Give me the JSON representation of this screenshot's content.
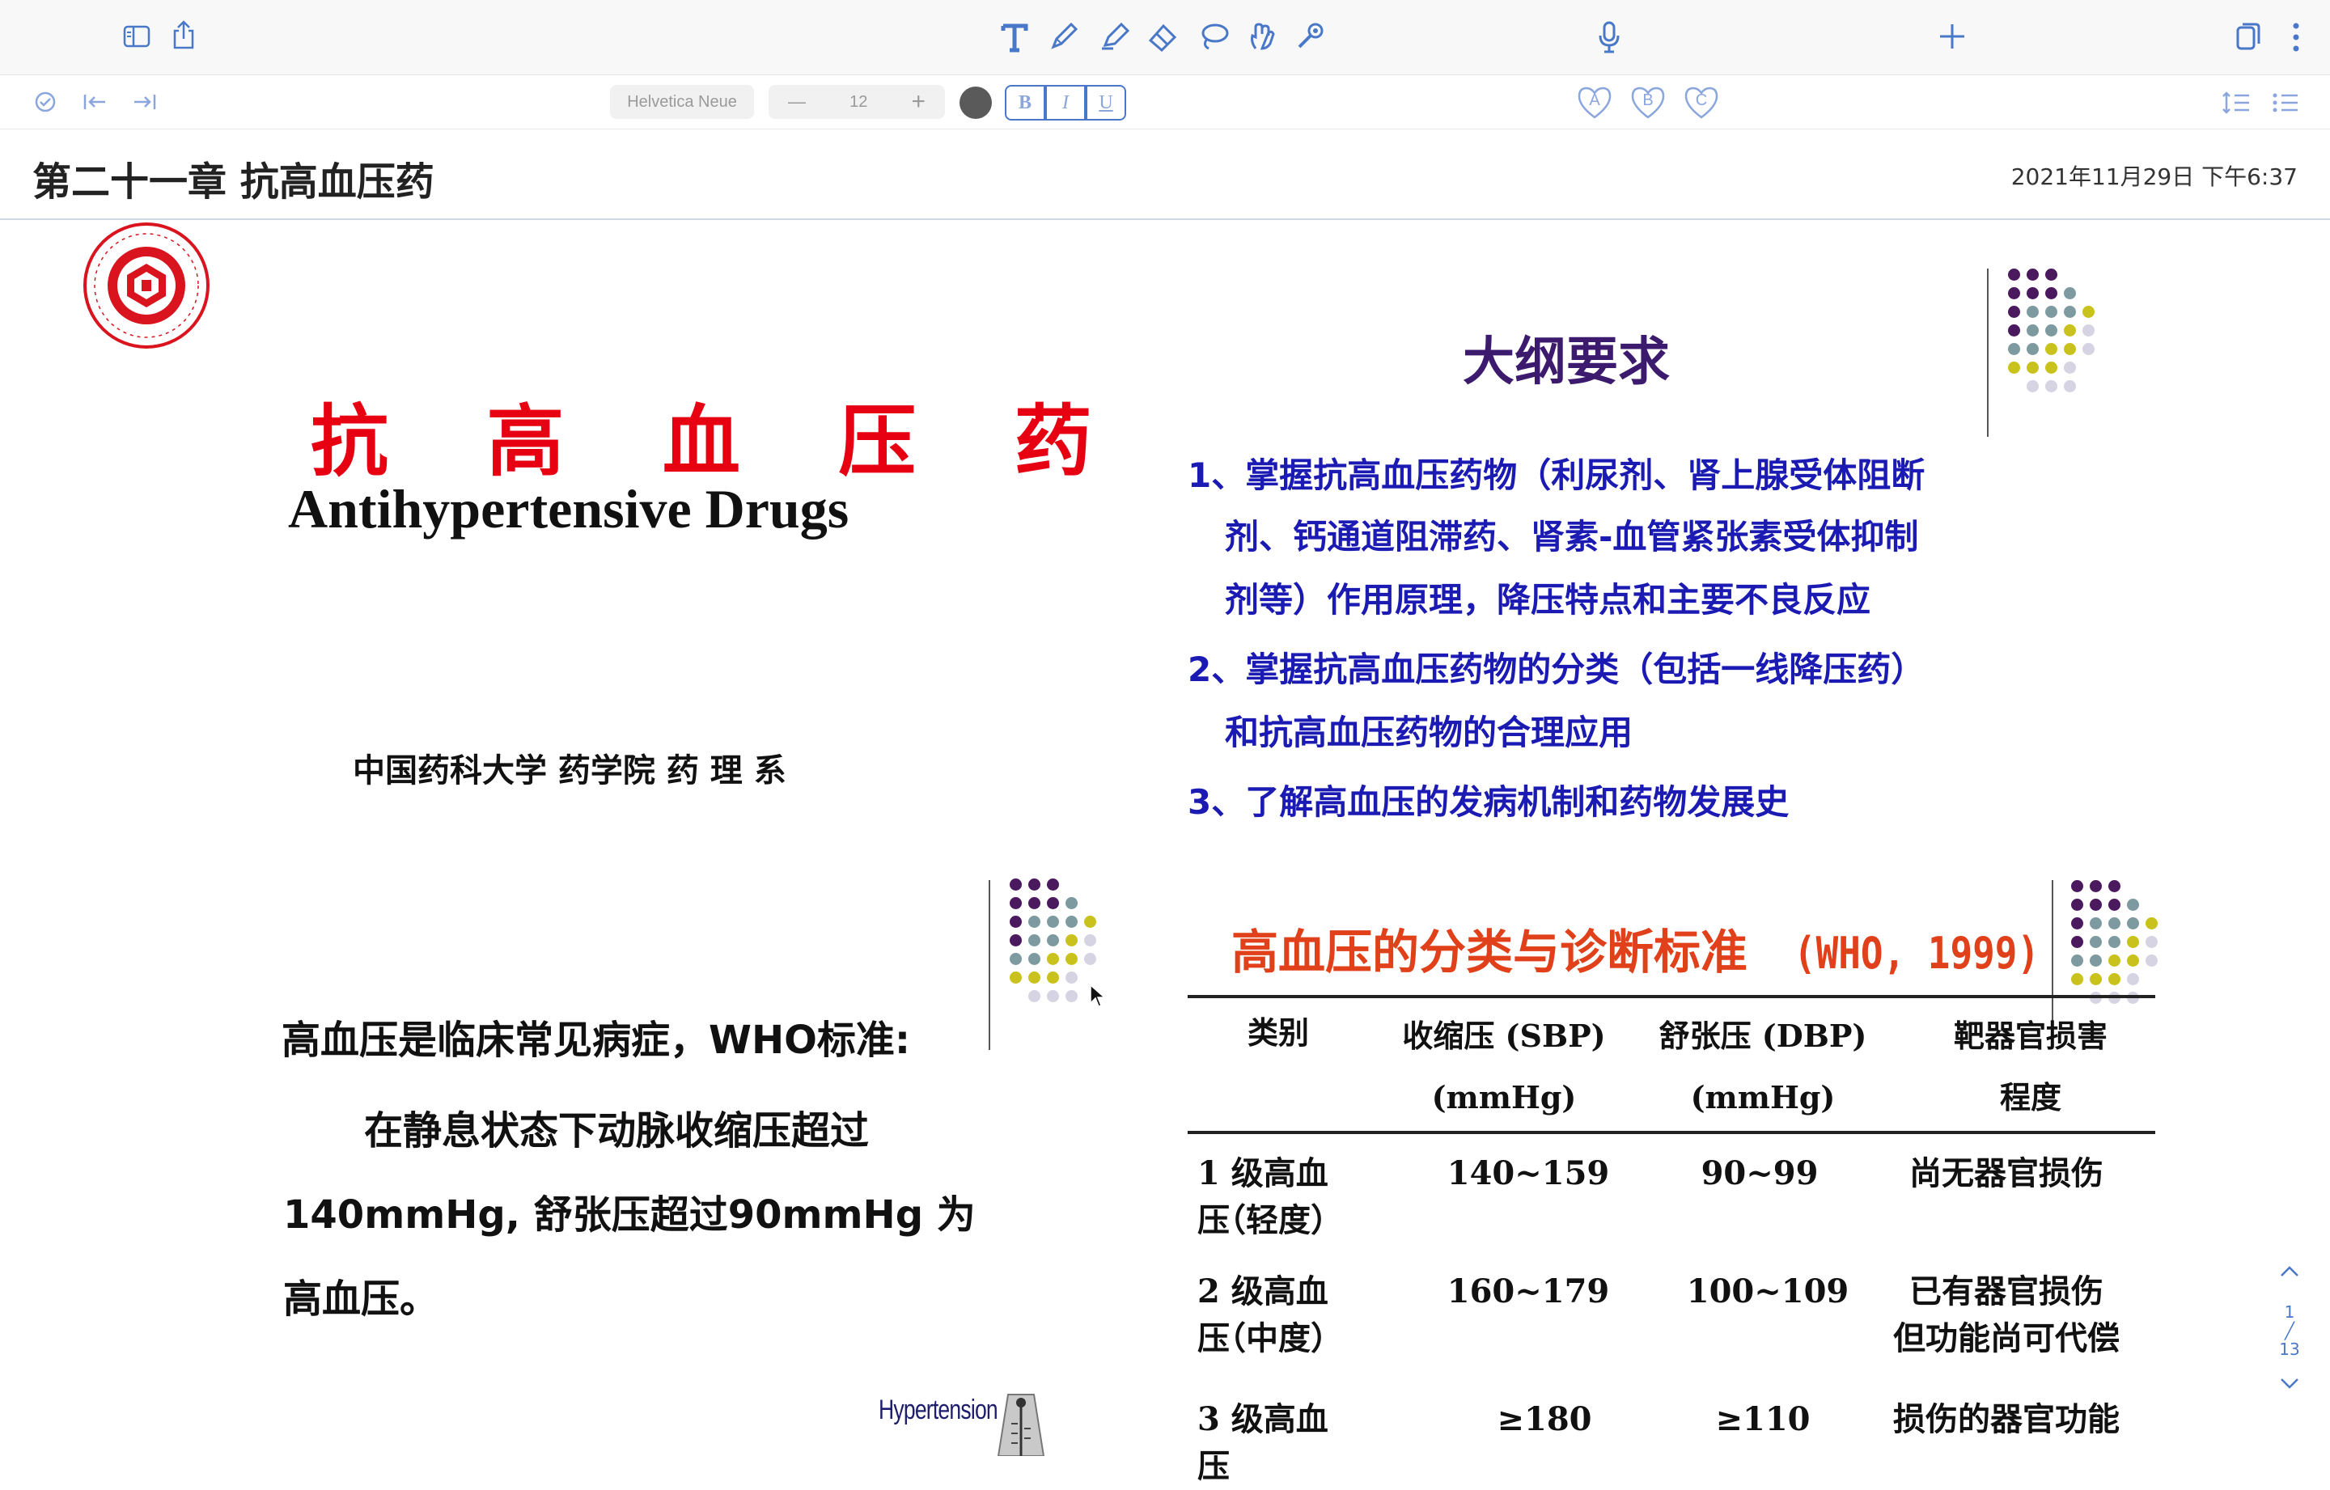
{
  "toolbar": {
    "font_name": "Helvetica Neue",
    "font_size": "12",
    "minus": "—",
    "plus": "+",
    "bold": "B",
    "italic": "I",
    "underline": "U",
    "fav_a": "A",
    "fav_b": "B",
    "fav_c": "C",
    "accent_color": "#4a78c8"
  },
  "header": {
    "title": "第二十一章 抗高血压药",
    "timestamp": "2021年11月29日 下午6:37"
  },
  "slide1": {
    "title_cn": "抗 高 血 压 药",
    "title_en": "Antihypertensive Drugs",
    "affiliation": "中国药科大学 药学院 药 理 系"
  },
  "slide2": {
    "heading": "大纲要求",
    "items": [
      "1、掌握抗高血压药物（利尿剂、肾上腺受体阻断",
      "剂、钙通道阻滞药、肾素-血管紧张素受体抑制",
      "剂等）作用原理，降压特点和主要不良反应",
      "2、掌握抗高血压药物的分类（包括一线降压药）",
      "和抗高血压药物的合理应用",
      "3、了解高血压的发病机制和药物发展史"
    ]
  },
  "slide3": {
    "line1": "高血压是临床常见病症，WHO标准:",
    "line2": "在静息状态下动脉收缩压超过",
    "line3": "140mmHg, 舒张压超过90mmHg 为",
    "line4": "高血压。",
    "image_label": "Hypertension"
  },
  "slide4": {
    "heading": "高血压的分类与诊断标准",
    "heading_tag": "(WHO, 1999)",
    "columns": [
      "类别",
      "收缩压 (SBP)",
      "舒张压 (DBP)",
      "靶器官损害"
    ],
    "column_units": [
      "",
      "(mmHg)",
      "(mmHg)",
      "程度"
    ],
    "rows": [
      {
        "grade": "1 级高血压",
        "level": "（轻度）",
        "sbp": "140~159",
        "dbp": "90~99",
        "organ": "尚无器官损伤",
        "organ2": ""
      },
      {
        "grade": "2 级高血压",
        "level": "（中度）",
        "sbp": "160~179",
        "dbp": "100~109",
        "organ": "已有器官损伤",
        "organ2": "但功能尚可代偿"
      },
      {
        "grade": "3 级高血压",
        "level": "",
        "sbp": "≥180",
        "dbp": "≥110",
        "organ": "损伤的器官功能",
        "organ2": ""
      }
    ]
  },
  "pager": {
    "current": "1",
    "separator": "╱",
    "total": "13"
  }
}
